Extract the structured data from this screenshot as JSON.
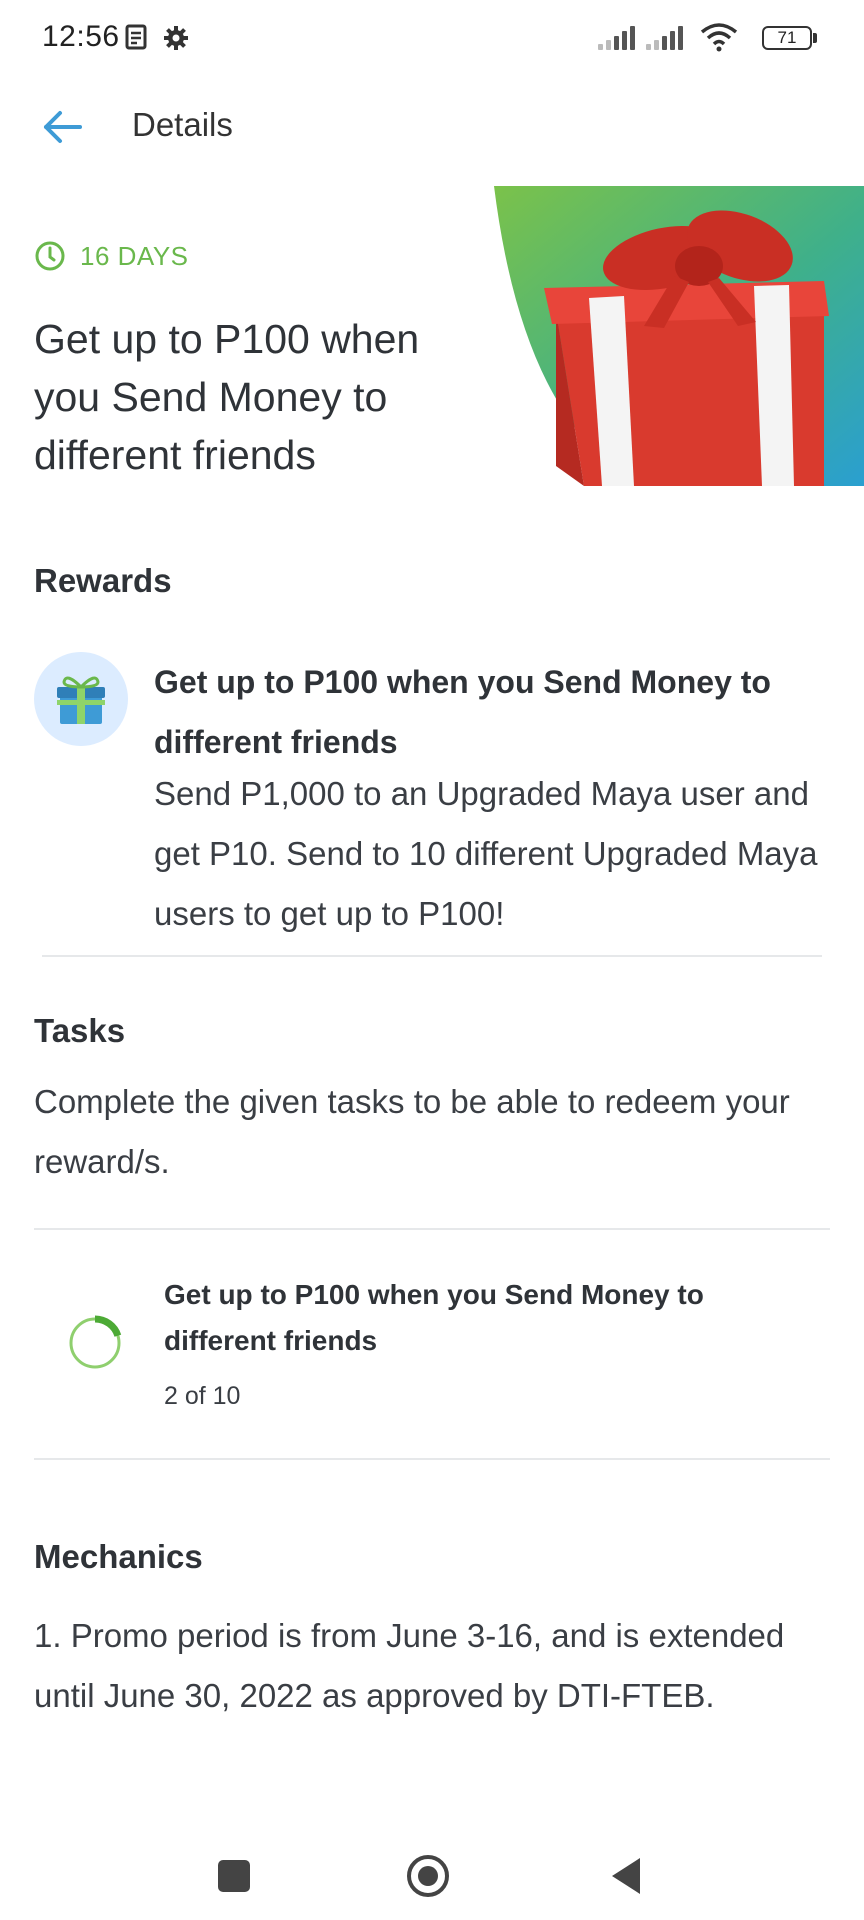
{
  "status_bar": {
    "time": "12:56",
    "battery": "71",
    "icons": [
      "notes-icon",
      "gear-icon",
      "signal-icon",
      "signal-icon",
      "wifi-icon",
      "battery-icon"
    ]
  },
  "header": {
    "title": "Details",
    "back_icon": "arrow-left-icon"
  },
  "promo": {
    "days_left": "16 DAYS",
    "title": "Get up to P100 when you Send Money to different friends",
    "image": "gift-box-illustration"
  },
  "rewards": {
    "heading": "Rewards",
    "item": {
      "icon": "gift-icon",
      "title": "Get up to P100 when you Send Money to different friends",
      "description": "Send P1,000 to an Upgraded Maya user and get P10. Send to 10 different Upgraded Maya users to get up to P100!"
    }
  },
  "tasks": {
    "heading": "Tasks",
    "description": "Complete the given tasks to be able to redeem your reward/s.",
    "items": [
      {
        "title": "Get up to P100 when you Send Money to different friends",
        "progress_text": "2 of 10",
        "progress_fraction": 0.2
      }
    ]
  },
  "mechanics": {
    "heading": "Mechanics",
    "text": "1. Promo period is from June 3-16, and is extended until June 30, 2022 as approved by DTI-FTEB."
  },
  "nav_bar": {
    "icons": [
      "recent-apps-icon",
      "home-icon",
      "back-triangle-icon"
    ]
  },
  "colors": {
    "accent_blue": "#3e9bd6",
    "green": "#6ab84c",
    "text": "#2f3338"
  }
}
